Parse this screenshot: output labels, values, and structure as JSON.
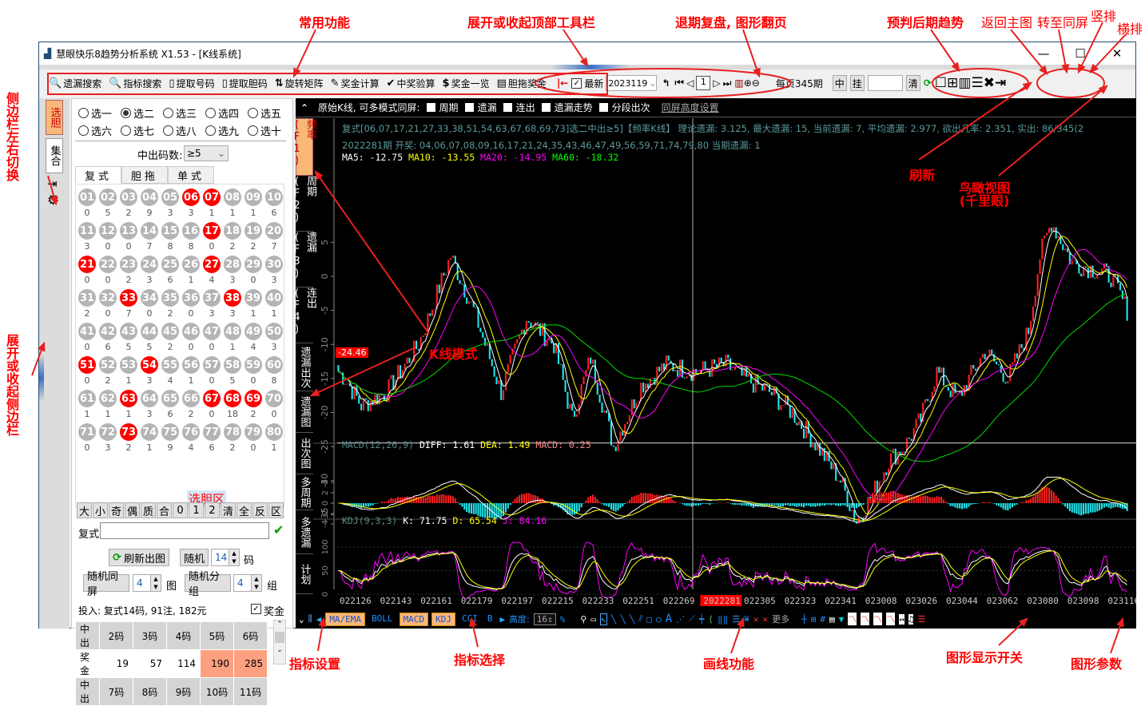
{
  "window": {
    "title": "慧眼快乐8趋势分析系统 X1.53 - [K线系统]",
    "minimize": "—",
    "maximize": "☐",
    "close": "✕"
  },
  "toolbar": {
    "items": [
      {
        "icon": "🔍",
        "label": "遗漏搜索"
      },
      {
        "icon": "🔍",
        "label": "指标搜索"
      },
      {
        "icon": "▯",
        "label": "提取号码"
      },
      {
        "icon": "▯",
        "label": "提取胆码"
      },
      {
        "icon": "⇅",
        "label": "旋转矩阵"
      },
      {
        "icon": "✎",
        "label": "奖金计算"
      },
      {
        "icon": "✔",
        "label": "中奖验算"
      },
      {
        "icon": "$",
        "label": "奖金一览"
      },
      {
        "icon": "▤",
        "label": "胆拖奖金"
      }
    ],
    "latest_label": "最新",
    "period_value": "2023119",
    "page_input": "1",
    "per_page": "每页345期",
    "zhong": "中",
    "gua": "挂",
    "predict_input": "",
    "qing": "清"
  },
  "sidebar": {
    "tab_active": "选胆",
    "tab_other": "集合"
  },
  "left_panel": {
    "radios": [
      {
        "label": "选一",
        "checked": false
      },
      {
        "label": "选二",
        "checked": true
      },
      {
        "label": "选三",
        "checked": false
      },
      {
        "label": "选四",
        "checked": false
      },
      {
        "label": "选五",
        "checked": false
      },
      {
        "label": "选六",
        "checked": false
      },
      {
        "label": "选七",
        "checked": false
      },
      {
        "label": "选八",
        "checked": false
      },
      {
        "label": "选九",
        "checked": false
      },
      {
        "label": "选十",
        "checked": false
      }
    ],
    "hit_count_label": "中出码数:",
    "hit_count_value": "≥5",
    "tabs": [
      "复式",
      "胆拖",
      "单式"
    ],
    "selected_numbers": [
      6,
      7,
      17,
      21,
      27,
      33,
      38,
      51,
      54,
      63,
      67,
      68,
      69,
      73
    ],
    "omissions": [
      0,
      5,
      2,
      9,
      3,
      3,
      1,
      1,
      1,
      6,
      3,
      0,
      0,
      7,
      8,
      8,
      0,
      2,
      2,
      7,
      0,
      0,
      2,
      3,
      6,
      1,
      4,
      3,
      0,
      3,
      2,
      0,
      7,
      0,
      2,
      0,
      3,
      3,
      1,
      1,
      0,
      6,
      5,
      5,
      2,
      0,
      0,
      1,
      4,
      3,
      0,
      2,
      1,
      3,
      4,
      1,
      0,
      5,
      0,
      8,
      1,
      1,
      1,
      3,
      6,
      2,
      0,
      18,
      2,
      0,
      0,
      3,
      2,
      1,
      9,
      4,
      6,
      2,
      0,
      1
    ],
    "filters": [
      "大",
      "小",
      "奇",
      "偶",
      "质",
      "合",
      "0",
      "1",
      "2",
      "清",
      "全",
      "反",
      "区"
    ],
    "fushi_label": "复式",
    "fushi_value": "",
    "refresh_label": "刷新出图",
    "random_label": "随机",
    "random_count": "14",
    "ma_label": "码",
    "random_screen_label": "随机同屏",
    "random_screen_count": "4",
    "tu_label": "图",
    "random_group_label": "随机分组",
    "random_group_count": "4",
    "zu_label": "组",
    "invest_text": "投入: 复式14码, 91注, 182元",
    "prize_check_label": "奖金",
    "prize_table": {
      "header": [
        "中出",
        "2码",
        "3码",
        "4码",
        "5码",
        "6码"
      ],
      "row": [
        "奖金",
        "19",
        "57",
        "114",
        "190",
        "285"
      ],
      "header2": [
        "中出",
        "7码",
        "8码",
        "9码",
        "10码",
        "11码"
      ]
    }
  },
  "chart": {
    "header_label": "原始K线, 可多模式同屏:",
    "header_checks": [
      "周期",
      "遗漏",
      "连出",
      "遗漏走势",
      "分段出次"
    ],
    "height_setting": "同屏高度设置",
    "side_tabs": [
      "频率(F1)",
      "周期(F2)",
      "遗漏(F3)",
      "连出(F4)",
      "遗漏出次",
      "遗漏图",
      "出次图",
      "多周期",
      "多遗漏",
      "计划"
    ],
    "info_line1": "复式[06,07,17,21,27,33,38,51,54,63,67,68,69,73]选二中出≥5]【频率K线】 理论遗漏: 3.125, 最大遗漏: 15, 当前遗漏: 7, 平均遗漏: 2.977, 欲出几率: 2.351, 实出: 86/345(2",
    "info_line2": "2022281期 开奖: 04,06,07,08,09,16,17,21,24,35,43,46,47,49,56,59,71,74,79,80 当期遗漏: 1",
    "ma": {
      "ma5": "MA5: -12.75",
      "ma10": "MA10: -13.55",
      "ma20": "MA20: -14.95",
      "ma60": "MA60: -18.32"
    },
    "crosshair_value": "-24.46",
    "macd": {
      "title": "MACD(12,26,9)",
      "diff": "DIFF: 1.61",
      "dea": "DEA: 1.49",
      "macd": "MACD: 0.25"
    },
    "kdj": {
      "title": "KDJ(9,3,3)",
      "k": "K: 71.75",
      "d": "D: 65.54",
      "j": "J: 84.16"
    },
    "colors": {
      "up": "#ff2020",
      "down": "#20e8f0",
      "ma5": "#ffffff",
      "ma10": "#ffff00",
      "ma20": "#ff00ff",
      "ma60": "#00dd00"
    },
    "bottom_buttons": [
      "MA/EMA",
      "BOLL",
      "MACD",
      "KDJ",
      "CCI",
      "B"
    ],
    "height_label": "高度:",
    "height_value": "16",
    "more_label": "更多"
  },
  "chart_data": {
    "type": "candlestick",
    "periods_per_page": 345,
    "ylim": [
      -38,
      8
    ],
    "yticks": [
      5,
      0,
      -5,
      -10,
      -15,
      -20,
      -25,
      -30,
      -35
    ],
    "macd_yticks": [
      4,
      2,
      0,
      -2,
      -4
    ],
    "kdj_yticks": [
      100,
      50,
      0
    ],
    "xticks": [
      "022126",
      "022143",
      "022161",
      "022179",
      "022197",
      "022215",
      "022233",
      "022251",
      "022269",
      "2022281",
      "022305",
      "022323",
      "022341",
      "023008",
      "023026",
      "023044",
      "023062",
      "023080",
      "023098",
      "023116"
    ],
    "highlighted_xtick": "2022281",
    "trend_keypoints": [
      [
        0,
        -14
      ],
      [
        3,
        -15
      ],
      [
        10,
        -19
      ],
      [
        21,
        -17
      ],
      [
        35,
        -10
      ],
      [
        49,
        3
      ],
      [
        59,
        -5
      ],
      [
        71,
        -17
      ],
      [
        82,
        -6
      ],
      [
        94,
        -10
      ],
      [
        102,
        -21
      ],
      [
        110,
        -12
      ],
      [
        120,
        -25
      ],
      [
        132,
        -16
      ],
      [
        143,
        -13
      ],
      [
        156,
        -14
      ],
      [
        169,
        -13
      ],
      [
        177,
        -15
      ],
      [
        188,
        -17
      ],
      [
        198,
        -20
      ],
      [
        209,
        -25
      ],
      [
        219,
        -30
      ],
      [
        226,
        -36
      ],
      [
        233,
        -32
      ],
      [
        240,
        -27
      ],
      [
        247,
        -25
      ],
      [
        254,
        -21
      ],
      [
        261,
        -14
      ],
      [
        270,
        -18
      ],
      [
        282,
        -11
      ],
      [
        292,
        -15
      ],
      [
        301,
        -8
      ],
      [
        306,
        3
      ],
      [
        311,
        8
      ],
      [
        320,
        2
      ],
      [
        330,
        1
      ],
      [
        337,
        0
      ],
      [
        344,
        -5
      ]
    ]
  },
  "annotations": {
    "common": "常用功能",
    "toggle_toolbar": "展开或收起顶部工具栏",
    "review": "退期复盘, 图形翻页",
    "predict": "预判后期趋势",
    "back_main": "返回主图",
    "same_screen": "转至同屏",
    "vertical": "竖排",
    "horizontal": "横排",
    "refresh": "刷新",
    "overview": "鸟瞰视图\n(千里眼)",
    "kline_mode": "K线模式",
    "pick_zone": "选胆区",
    "side_switch": "侧边栏左右切换",
    "side_toggle": "展开或收起侧边栏",
    "indicator_settings": "指标设置",
    "indicator_select": "指标选择",
    "drawing": "画线功能",
    "display_switch": "图形显示开关",
    "graph_params": "图形参数"
  }
}
